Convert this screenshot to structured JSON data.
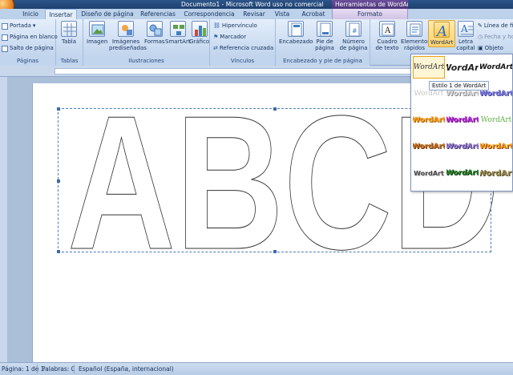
{
  "window": {
    "title": "Documento1 - Microsoft Word uso no comercial",
    "context_title": "Herramientas de WordArt"
  },
  "tabs": [
    "Inicio",
    "Insertar",
    "Diseño de página",
    "Referencias",
    "Correspondencia",
    "Revisar",
    "Vista",
    "Acrobat",
    "Formato"
  ],
  "active_tab": "Insertar",
  "ribbon": {
    "paginas": {
      "label": "Páginas",
      "items": [
        "Portada",
        "Página en blanco",
        "Salto de página"
      ]
    },
    "tablas": {
      "label": "Tablas",
      "items": [
        "Tabla"
      ]
    },
    "ilustraciones": {
      "label": "Ilustraciones",
      "items": [
        "Imagen",
        "Imágenes prediseñadas",
        "Formas",
        "SmartArt",
        "Gráfico"
      ]
    },
    "vinculos": {
      "label": "Vínculos",
      "items": [
        "Hipervínculo",
        "Marcador",
        "Referencia cruzada"
      ]
    },
    "encabezado": {
      "label": "Encabezado y pie de página",
      "items": [
        "Encabezado",
        "Pie de página",
        "Número de página"
      ]
    },
    "texto": {
      "items": [
        "Cuadro de texto",
        "Elementos rápidos",
        "WordArt",
        "Letra capital"
      ],
      "small": [
        "Línea de fi",
        "Fecha y ho",
        "Objeto"
      ]
    }
  },
  "document": {
    "wordart_text": "ABCD"
  },
  "wordart_gallery": {
    "tooltip": "Estilo 1 de WordArt",
    "samples": [
      "WordArt",
      "WordArt",
      "WordArt",
      "WordArt",
      "WordArt",
      "WordArt",
      "WordArt",
      "WordArt",
      "WordArt",
      "WordArt",
      "WordArt",
      "WordArt",
      "WordArt",
      "WordArt",
      "WordArt"
    ]
  },
  "statusbar": {
    "page": "Página: 1 de 1",
    "words": "Palabras: 0",
    "language": "Español (España, internacional)"
  }
}
